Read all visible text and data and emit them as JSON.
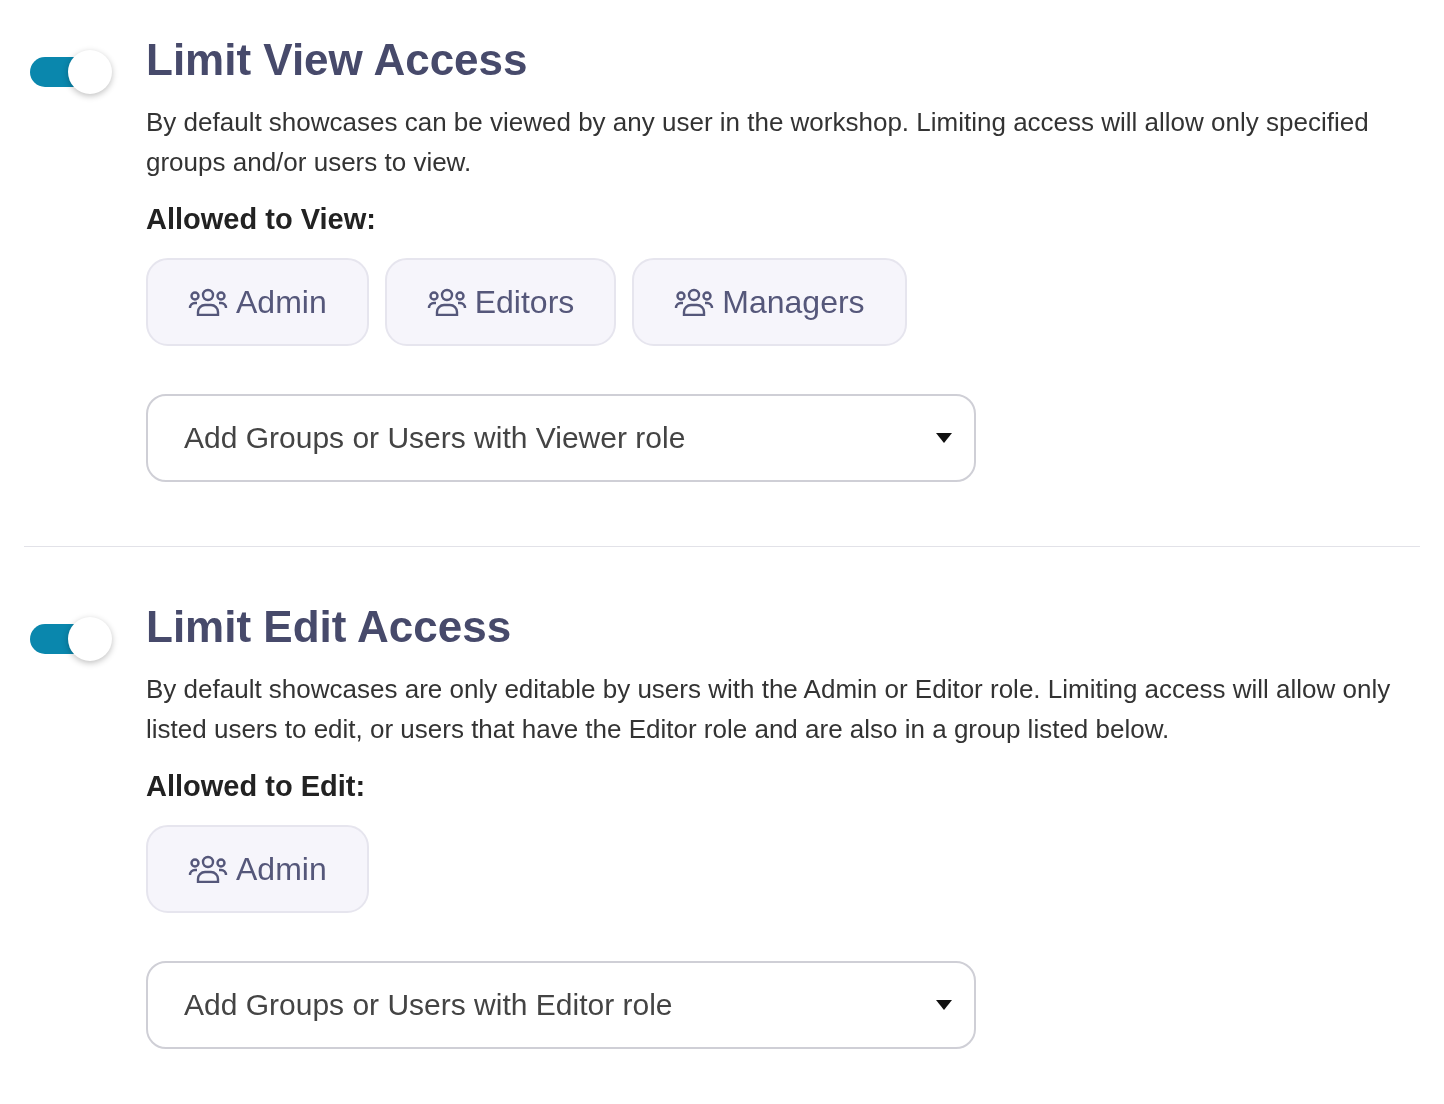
{
  "sections": [
    {
      "enabled": true,
      "title": "Limit View Access",
      "description": "By default showcases can be viewed by any user in the workshop. Limiting access will allow only specified groups and/or users to view.",
      "list_label": "Allowed to View:",
      "chips": [
        {
          "label": "Admin"
        },
        {
          "label": "Editors"
        },
        {
          "label": "Managers"
        }
      ],
      "dropdown": {
        "placeholder": "Add Groups or Users with Viewer role"
      }
    },
    {
      "enabled": true,
      "title": "Limit Edit Access",
      "description": "By default showcases are only editable by users with the Admin or Editor role. Limiting access will allow only listed users to edit, or users that have the Editor role and are also in a group listed below.",
      "list_label": "Allowed to Edit:",
      "chips": [
        {
          "label": "Admin"
        }
      ],
      "dropdown": {
        "placeholder": "Add Groups or Users with Editor role"
      }
    }
  ]
}
